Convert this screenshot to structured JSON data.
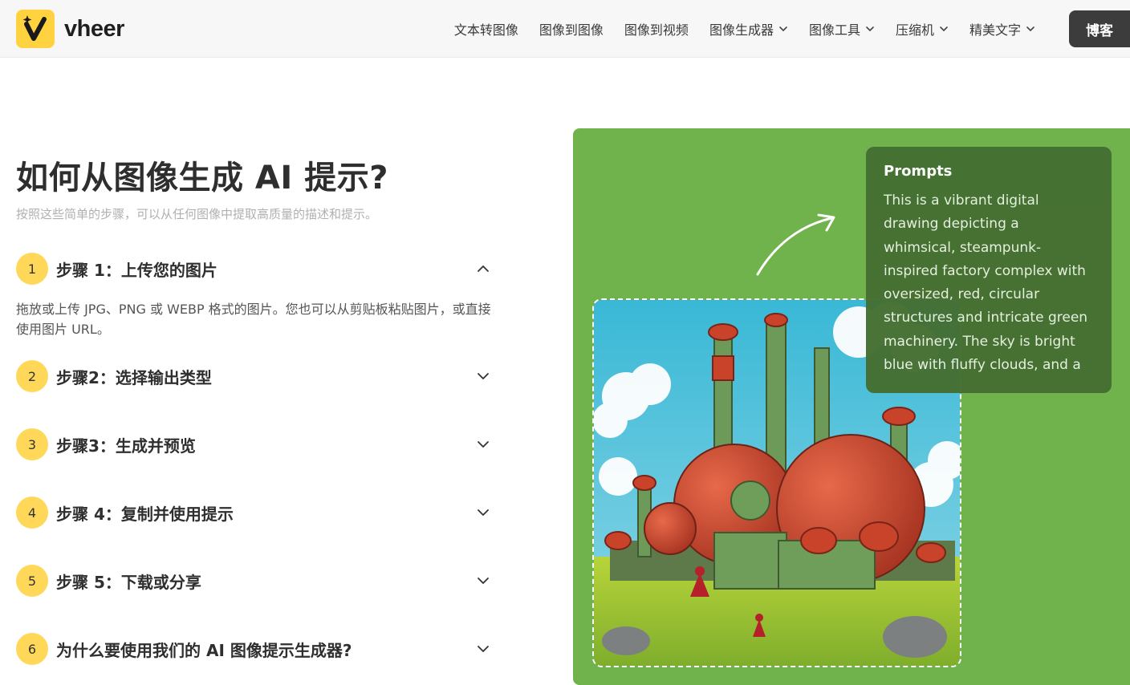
{
  "brand": {
    "name": "vheer"
  },
  "nav": {
    "items": [
      {
        "label": "文本转图像",
        "dropdown": false
      },
      {
        "label": "图像到图像",
        "dropdown": false
      },
      {
        "label": "图像到视频",
        "dropdown": false
      },
      {
        "label": "图像生成器",
        "dropdown": true
      },
      {
        "label": "图像工具",
        "dropdown": true
      },
      {
        "label": "压缩机",
        "dropdown": true
      },
      {
        "label": "精美文字",
        "dropdown": true
      }
    ],
    "blog_label": "博客"
  },
  "main": {
    "title": "如何从图像生成 AI 提示?",
    "subtitle": "按照这些简单的步骤，可以从任何图像中提取高质量的描述和提示。",
    "steps": [
      {
        "number": "1",
        "title": "步骤 1：上传您的图片",
        "expanded": true,
        "body": "拖放或上传 JPG、PNG 或 WEBP 格式的图片。您也可以从剪贴板粘贴图片，或直接使用图片 URL。"
      },
      {
        "number": "2",
        "title": "步骤2：选择输出类型",
        "expanded": false
      },
      {
        "number": "3",
        "title": "步骤3：生成并预览",
        "expanded": false
      },
      {
        "number": "4",
        "title": "步骤 4：复制并使用提示",
        "expanded": false
      },
      {
        "number": "5",
        "title": "步骤 5：下载或分享",
        "expanded": false
      },
      {
        "number": "6",
        "title": "为什么要使用我们的 AI 图像提示生成器?",
        "expanded": false
      }
    ]
  },
  "illustration": {
    "prompt_title": "Prompts",
    "prompt_text": "This is a vibrant digital drawing depicting a whimsical, steampunk-inspired factory complex with oversized, red, circular structures and intricate green machinery. The sky is bright blue with fluffy clouds, and a grassy field with small..."
  },
  "colors": {
    "accent_yellow": "#ffd85a",
    "panel_green": "#70b34c",
    "card_green": "#456f32",
    "blog_button": "#3c3c3c"
  }
}
